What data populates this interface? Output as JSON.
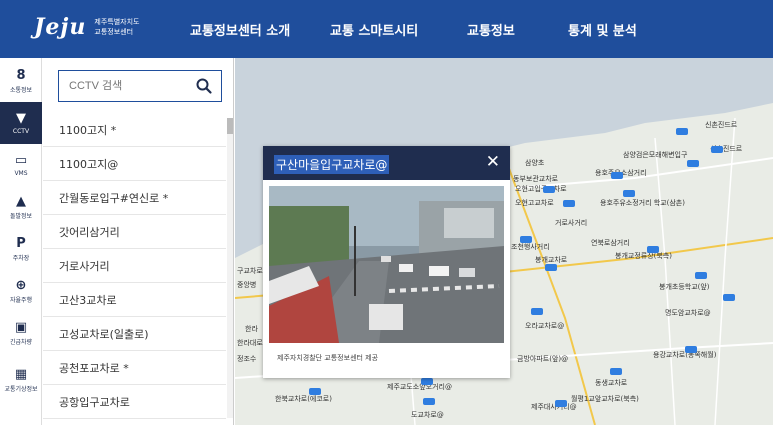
{
  "header": {
    "logo_word": "Jeju",
    "logo_sub_line1": "제주특별자치도",
    "logo_sub_line2": "교통정보센터",
    "nav": [
      "교통정보센터 소개",
      "교통 스마트시티",
      "교통정보",
      "통계 및 분석"
    ]
  },
  "rail": [
    {
      "label": "소통정보",
      "icon": "traffic-light-icon",
      "glyph": "8"
    },
    {
      "label": "CCTV",
      "icon": "cctv-camera-icon",
      "glyph": "▼"
    },
    {
      "label": "VMS",
      "icon": "vms-sign-icon",
      "glyph": "▭"
    },
    {
      "label": "돌발정보",
      "icon": "warning-triangle-icon",
      "glyph": "▲"
    },
    {
      "label": "주차장",
      "icon": "parking-icon",
      "glyph": "P"
    },
    {
      "label": "자율주행",
      "icon": "steering-wheel-icon",
      "glyph": "⊕"
    },
    {
      "label": "긴급차량",
      "icon": "emergency-vehicle-icon",
      "glyph": "▣"
    },
    {
      "label": "교통기상정보",
      "icon": "weather-car-icon",
      "glyph": "▦"
    }
  ],
  "search": {
    "placeholder": "CCTV 검색",
    "icon": "search-icon"
  },
  "list": [
    "1100고지 *",
    "1100고지@",
    "간월동로입구#연신로 *",
    "갓어리삼거리",
    "거로사거리",
    "고산3교차로",
    "고성교차로(일출로)",
    "공천포교차로 *",
    "공항입구교차로"
  ],
  "popup": {
    "title": "구산마을입구교차로@",
    "close": "✕",
    "caption": "제주자치경찰단 교통정보센터 제공"
  },
  "map_labels": [
    "신촌진드르",
    "신촌진드르",
    "삼양검은모래해변입구",
    "삼양초",
    "용호주유소삼거리",
    "용호주유소정거리 학교(삼촌)",
    "동부보관교차로",
    "오현고입구교차로",
    "오현고교차로",
    "거로사거리",
    "조천행사거리",
    "연북로삼거리",
    "봉개교차로",
    "봉개교정류장(북측)",
    "봉개초등학교(앞)",
    "명도암교차로@",
    "구교차로",
    "중앙병",
    "한라",
    "한라대로",
    "정조수",
    "용강교차로(동쪽해월)",
    "동생교차로",
    "오라교차로@",
    "제주교도소앞오거리@",
    "제주대사거리@",
    "월평1교앞교차로(북측)",
    "한북교차로(에코로)",
    "금방아파트(앞)@",
    "도교차로@"
  ],
  "colors": {
    "header": "#1f4e9c",
    "rail_active": "#1f2d4f",
    "popup_head": "#1f2d4f",
    "map_land": "#e9ece6",
    "map_sea": "#c9d3dc",
    "camera_marker": "#2f7de0"
  }
}
